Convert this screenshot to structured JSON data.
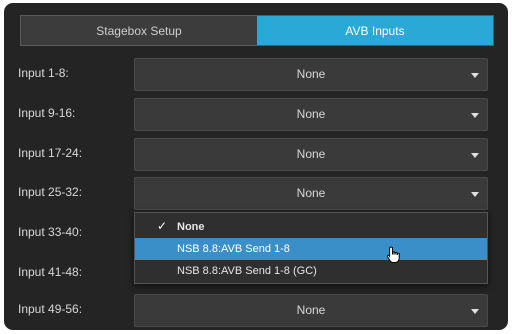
{
  "tabs": [
    "Stagebox Setup",
    "AVB Inputs"
  ],
  "active_tab": "AVB Inputs",
  "inputs": [
    {
      "label": "Input 1-8:",
      "value": "None"
    },
    {
      "label": "Input 9-16:",
      "value": "None"
    },
    {
      "label": "Input 17-24:",
      "value": "None"
    },
    {
      "label": "Input 25-32:",
      "value": "None"
    },
    {
      "label": "Input 33-40:",
      "value": ""
    },
    {
      "label": "Input 41-48:",
      "value": ""
    },
    {
      "label": "Input 49-56:",
      "value": "None"
    }
  ],
  "dropdown": {
    "options": [
      "None",
      "NSB 8.8:AVB Send 1-8",
      "NSB 8.8:AVB Send 1-8 (GC)"
    ],
    "checked": "None",
    "highlighted": "NSB 8.8:AVB Send 1-8"
  },
  "colors": {
    "accent": "#2aa8d6",
    "highlight": "#3a8fc8",
    "panel": "#242424"
  },
  "icons": {
    "check": "check-icon",
    "caret": "chevron-down-icon",
    "cursor": "hand-pointer-icon"
  }
}
